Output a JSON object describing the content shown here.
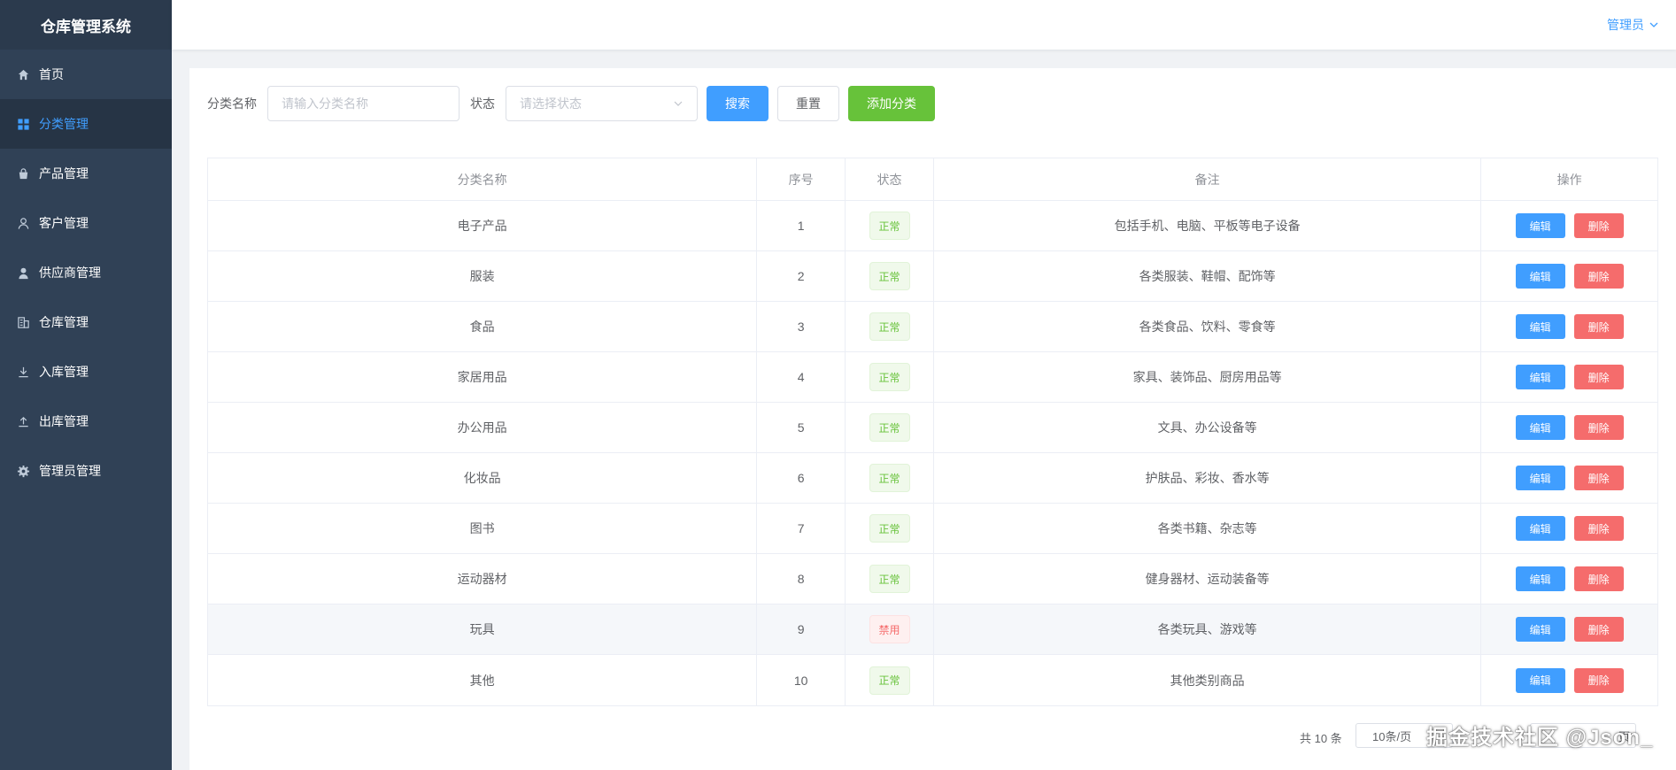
{
  "app_title": "仓库管理系统",
  "sidebar": {
    "items": [
      {
        "label": "首页",
        "icon": "home-icon",
        "active": false
      },
      {
        "label": "分类管理",
        "icon": "grid-icon",
        "active": true
      },
      {
        "label": "产品管理",
        "icon": "bag-icon",
        "active": false
      },
      {
        "label": "客户管理",
        "icon": "user-outline-icon",
        "active": false
      },
      {
        "label": "供应商管理",
        "icon": "user-filled-icon",
        "active": false
      },
      {
        "label": "仓库管理",
        "icon": "office-building-icon",
        "active": false
      },
      {
        "label": "入库管理",
        "icon": "download-icon",
        "active": false
      },
      {
        "label": "出库管理",
        "icon": "upload-icon",
        "active": false
      },
      {
        "label": "管理员管理",
        "icon": "gear-icon",
        "active": false
      }
    ]
  },
  "header": {
    "user_label": "管理员"
  },
  "search": {
    "name_label": "分类名称",
    "name_placeholder": "请输入分类名称",
    "status_label": "状态",
    "status_placeholder": "请选择状态",
    "search_button": "搜索",
    "reset_button": "重置",
    "add_button": "添加分类"
  },
  "table": {
    "columns": [
      "分类名称",
      "序号",
      "状态",
      "备注",
      "操作"
    ],
    "edit_label": "编辑",
    "delete_label": "删除",
    "rows": [
      {
        "name": "电子产品",
        "index": "1",
        "status": "正常",
        "remark": "包括手机、电脑、平板等电子设备"
      },
      {
        "name": "服装",
        "index": "2",
        "status": "正常",
        "remark": "各类服装、鞋帽、配饰等"
      },
      {
        "name": "食品",
        "index": "3",
        "status": "正常",
        "remark": "各类食品、饮料、零食等"
      },
      {
        "name": "家居用品",
        "index": "4",
        "status": "正常",
        "remark": "家具、装饰品、厨房用品等"
      },
      {
        "name": "办公用品",
        "index": "5",
        "status": "正常",
        "remark": "文具、办公设备等"
      },
      {
        "name": "化妆品",
        "index": "6",
        "status": "正常",
        "remark": "护肤品、彩妆、香水等"
      },
      {
        "name": "图书",
        "index": "7",
        "status": "正常",
        "remark": "各类书籍、杂志等"
      },
      {
        "name": "运动器材",
        "index": "8",
        "status": "正常",
        "remark": "健身器材、运动装备等"
      },
      {
        "name": "玩具",
        "index": "9",
        "status": "禁用",
        "remark": "各类玩具、游戏等"
      },
      {
        "name": "其他",
        "index": "10",
        "status": "正常",
        "remark": "其他类别商品"
      }
    ]
  },
  "pagination": {
    "total_text": "共 10 条",
    "page_size": "10条/页",
    "goto_suffix": "页"
  },
  "watermark": "掘金技术社区 @Json_"
}
